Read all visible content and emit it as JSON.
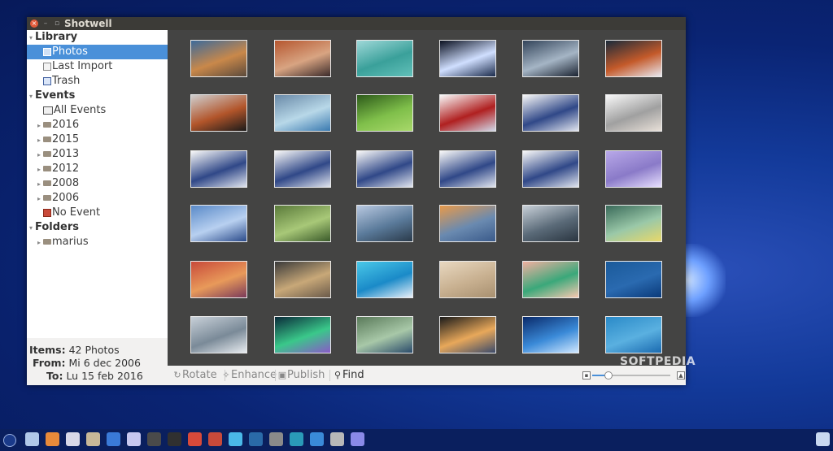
{
  "window": {
    "title": "Shotwell"
  },
  "sidebar": {
    "library_header": "Library",
    "library_items": [
      {
        "label": "Photos",
        "icon": "photo-icon",
        "selected": true
      },
      {
        "label": "Last Import",
        "icon": "import-icon"
      },
      {
        "label": "Trash",
        "icon": "trash-icon"
      }
    ],
    "events_header": "Events",
    "events_items": [
      {
        "label": "All Events",
        "icon": "events-icon",
        "expandable": false
      },
      {
        "label": "2016",
        "icon": "folder-icon",
        "expandable": true
      },
      {
        "label": "2015",
        "icon": "folder-icon",
        "expandable": true
      },
      {
        "label": "2013",
        "icon": "folder-icon",
        "expandable": true
      },
      {
        "label": "2012",
        "icon": "folder-icon",
        "expandable": true
      },
      {
        "label": "2008",
        "icon": "folder-icon",
        "expandable": true
      },
      {
        "label": "2006",
        "icon": "folder-icon",
        "expandable": true
      },
      {
        "label": "No Event",
        "icon": "no-event-icon",
        "expandable": false
      }
    ],
    "folders_header": "Folders",
    "folders_items": [
      {
        "label": "marius",
        "icon": "folder-icon",
        "expandable": true
      }
    ]
  },
  "info": {
    "items_label": "Items:",
    "items_value": "42 Photos",
    "from_label": "From:",
    "from_value": "Mi 6 dec 2006",
    "to_label": "To:",
    "to_value": "Lu 15 feb 2016"
  },
  "toolbar": {
    "rotate_label": "Rotate",
    "enhance_label": "Enhance",
    "publish_label": "Publish",
    "find_label": "Find",
    "zoom_level": 0.2
  },
  "watermark": "SOFTPEDIA",
  "photos": [
    [
      "#3d6a9a",
      "#c9884a",
      "#5b4a3c"
    ],
    [
      "#b5562f",
      "#d8a482",
      "#3a2a2a"
    ],
    [
      "#9fd8d8",
      "#3aa09a",
      "#62c0b9"
    ],
    [
      "#0a1020",
      "#d0dfff",
      "#1a2a4a"
    ],
    [
      "#33445a",
      "#a5b5c5",
      "#1a2230"
    ],
    [
      "#1a2a3a",
      "#c45a2a",
      "#e8e8f0"
    ],
    [
      "#cfcfcf",
      "#b2552a",
      "#1a1a1a"
    ],
    [
      "#6a8aa8",
      "#b8d8e8",
      "#3a7ab0"
    ],
    [
      "#2d5a1a",
      "#7fbf4a",
      "#a8d86a"
    ],
    [
      "#f8f8f8",
      "#b02020",
      "#d0d8e8"
    ],
    [
      "#f8f8f8",
      "#304888",
      "#e0e4ee"
    ],
    [
      "#f8f8f8",
      "#a0a0a0",
      "#e8e0d8"
    ],
    [
      "#f8f8f8",
      "#304888",
      "#e0e4ee"
    ],
    [
      "#f8f8f8",
      "#304888",
      "#e0e4ee"
    ],
    [
      "#f8f8f8",
      "#304888",
      "#e0e4ee"
    ],
    [
      "#f8f8f8",
      "#304888",
      "#e0e4ee"
    ],
    [
      "#f8f8f8",
      "#304888",
      "#e0e4ee"
    ],
    [
      "#b8a8e8",
      "#8a7ac8",
      "#e8e0ff"
    ],
    [
      "#5a8ac8",
      "#b8d0f0",
      "#2a4a8a"
    ],
    [
      "#5a7a3a",
      "#a8c878",
      "#3a5a2a"
    ],
    [
      "#b8c8e0",
      "#5a7a9a",
      "#2a3a4a"
    ],
    [
      "#e89a4a",
      "#6a8ab0",
      "#3a5a8a"
    ],
    [
      "#c8d0d8",
      "#5a6a78",
      "#2a3540"
    ],
    [
      "#3a6a5a",
      "#9ac8a8",
      "#e8d86a"
    ],
    [
      "#c84a3a",
      "#e89a5a",
      "#7a3a5a"
    ],
    [
      "#3a3a3a",
      "#c8a878",
      "#6a5a4a"
    ],
    [
      "#4ac8e8",
      "#1a8ac8",
      "#e8f0f8"
    ],
    [
      "#e8d8c0",
      "#c8b090",
      "#a89070"
    ],
    [
      "#f0b0a0",
      "#3aa87a",
      "#f8c8b0"
    ],
    [
      "#1a5a9a",
      "#2a6ab0",
      "#0a3a7a"
    ],
    [
      "#c8d0d8",
      "#7a8a98",
      "#e8ecf0"
    ],
    [
      "#0a2a3a",
      "#3ac88a",
      "#8a5ac8"
    ],
    [
      "#5a7a5a",
      "#a8c8a8",
      "#2a4a6a"
    ],
    [
      "#1a1a1a",
      "#e8a85a",
      "#3a4a6a"
    ],
    [
      "#0a2a6a",
      "#3a8ad8",
      "#d0e8ff"
    ],
    [
      "#2a8ac8",
      "#5ab0e0",
      "#1a6ab0"
    ]
  ],
  "taskbar_icons": [
    "#b0c8e8",
    "#e88a3a",
    "#d8d8e8",
    "#c8b898",
    "#3a7ad8",
    "#c8c8f0",
    "#4a4a4a",
    "#303030",
    "#d84a3a",
    "#c84a3a",
    "#4ab8e8",
    "#2a6aa8",
    "#8a8a8a",
    "#2a9ab8",
    "#3a8ad8",
    "#b8b8b8",
    "#8a8ae8"
  ]
}
